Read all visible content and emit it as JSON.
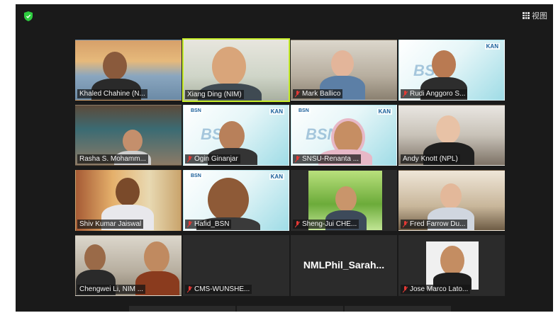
{
  "toolbar": {
    "view_label": "视图"
  },
  "participants": [
    {
      "name": "Khaled Chahine (N...",
      "muted": false
    },
    {
      "name": "Xiang Ding (NIM)",
      "muted": false,
      "active": true
    },
    {
      "name": "Mark Ballico",
      "muted": true
    },
    {
      "name": "Rudi Anggoro S...",
      "muted": true
    },
    {
      "name": "Rasha S. Mohamm...",
      "muted": false
    },
    {
      "name": "Ogin Ginanjar",
      "muted": true
    },
    {
      "name": "SNSU-Renanta ...",
      "muted": true
    },
    {
      "name": "Andy Knott (NPL)",
      "muted": false
    },
    {
      "name": "Shiv Kumar Jaiswal",
      "muted": false
    },
    {
      "name": "Hafid_BSN",
      "muted": true
    },
    {
      "name": "Sheng-Jui CHE...",
      "muted": true
    },
    {
      "name": "Fred Farrow Du...",
      "muted": true
    },
    {
      "name": "Chengwei Li, NIM ...",
      "muted": false
    },
    {
      "name": "CMS-WUNSHE...",
      "muted": true
    },
    {
      "name": "NMLPhil_Sarah...",
      "muted": false,
      "video_off": true
    },
    {
      "name": "Jose Marco Lato...",
      "muted": true
    }
  ],
  "overlay": {
    "bsn_label": "BSN",
    "kan_label": "KAN"
  },
  "colors": {
    "active_border": "#c9f02a",
    "mute_icon": "#e53935",
    "shield": "#2ecc40",
    "background": "#1a1a1a"
  }
}
